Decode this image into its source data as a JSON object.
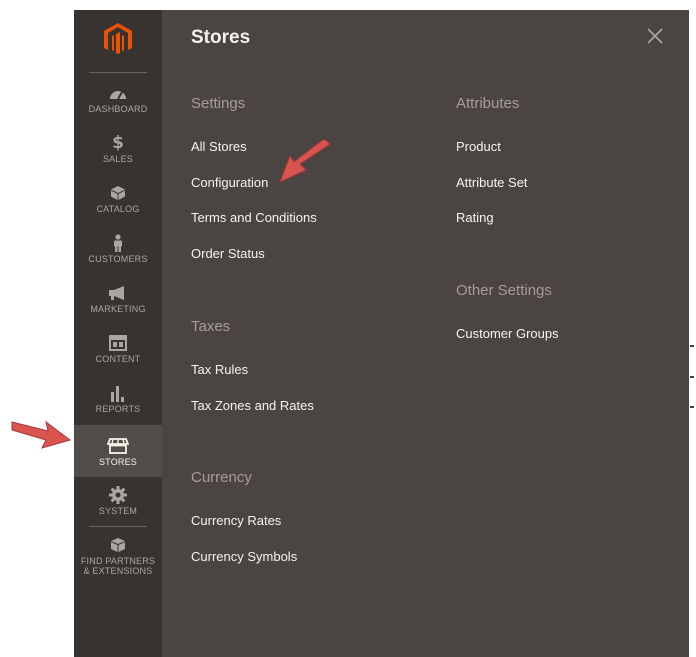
{
  "theme": {
    "sidebar_bg": "#373330",
    "panel_bg": "#4a4542",
    "active_bg": "#524d49",
    "accent": "#eb5202",
    "arrow_color": "#d9534f"
  },
  "sidebar": {
    "items": [
      {
        "label": "DASHBOARD",
        "icon": "dashboard-icon"
      },
      {
        "label": "SALES",
        "icon": "dollar-icon"
      },
      {
        "label": "CATALOG",
        "icon": "cube-icon"
      },
      {
        "label": "CUSTOMERS",
        "icon": "person-icon"
      },
      {
        "label": "MARKETING",
        "icon": "megaphone-icon"
      },
      {
        "label": "CONTENT",
        "icon": "layout-icon"
      },
      {
        "label": "REPORTS",
        "icon": "bar-chart-icon"
      },
      {
        "label": "STORES",
        "icon": "storefront-icon",
        "active": true
      },
      {
        "label": "SYSTEM",
        "icon": "gear-icon"
      },
      {
        "label": "FIND PARTNERS & EXTENSIONS",
        "icon": "boxes-icon"
      }
    ]
  },
  "panel": {
    "title": "Stores",
    "close_icon": "close-icon",
    "sections": {
      "settings": {
        "title": "Settings",
        "links": [
          "All Stores",
          "Configuration",
          "Terms and Conditions",
          "Order Status"
        ]
      },
      "taxes": {
        "title": "Taxes",
        "links": [
          "Tax Rules",
          "Tax Zones and Rates"
        ]
      },
      "currency": {
        "title": "Currency",
        "links": [
          "Currency Rates",
          "Currency Symbols"
        ]
      },
      "attributes": {
        "title": "Attributes",
        "links": [
          "Product",
          "Attribute Set",
          "Rating"
        ]
      },
      "other_settings": {
        "title": "Other Settings",
        "links": [
          "Customer Groups"
        ]
      }
    }
  }
}
